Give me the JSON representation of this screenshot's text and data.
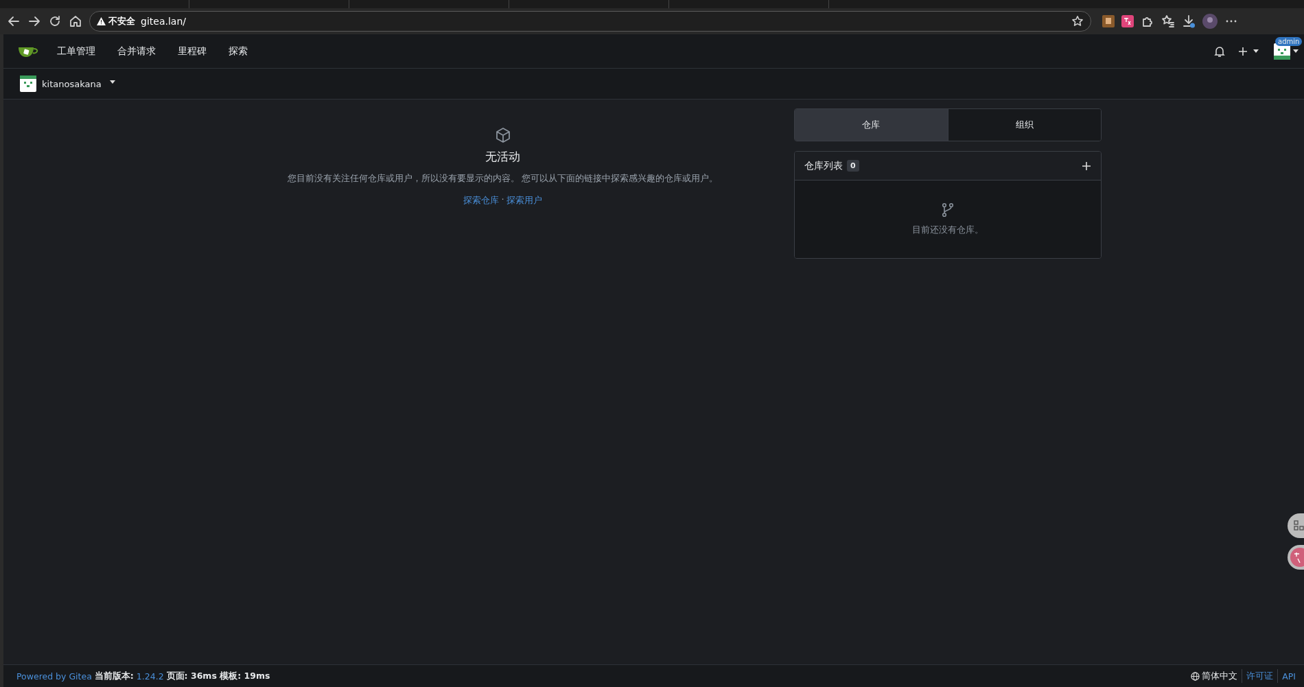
{
  "browser": {
    "security_label": "不安全",
    "url": "gitea.lan/"
  },
  "nav": {
    "items": [
      {
        "label": "工单管理"
      },
      {
        "label": "合并请求"
      },
      {
        "label": "里程碑"
      },
      {
        "label": "探索"
      }
    ],
    "avatar_badge": "admin"
  },
  "context": {
    "user": "kitanosakana"
  },
  "feed": {
    "title": "无活动",
    "message": "您目前没有关注任何仓库或用户，所以没有要显示的内容。 您可以从下面的链接中探索感兴趣的仓库或用户。",
    "links": [
      {
        "label": "探索仓库"
      },
      {
        "label": "探索用户"
      }
    ],
    "separator": "·"
  },
  "sidebar": {
    "tabs": [
      {
        "label": "仓库",
        "selected": true
      },
      {
        "label": "组织",
        "selected": false
      }
    ],
    "repo_list": {
      "title": "仓库列表",
      "count": "0",
      "empty_text": "目前还没有仓库。"
    }
  },
  "footer": {
    "powered_by": "Powered by Gitea",
    "version_label": "当前版本:",
    "version": "1.24.2",
    "timing": "页面: 36ms 模板: 19ms",
    "language": "简体中文",
    "links": [
      {
        "label": "许可证"
      },
      {
        "label": "API"
      }
    ]
  }
}
